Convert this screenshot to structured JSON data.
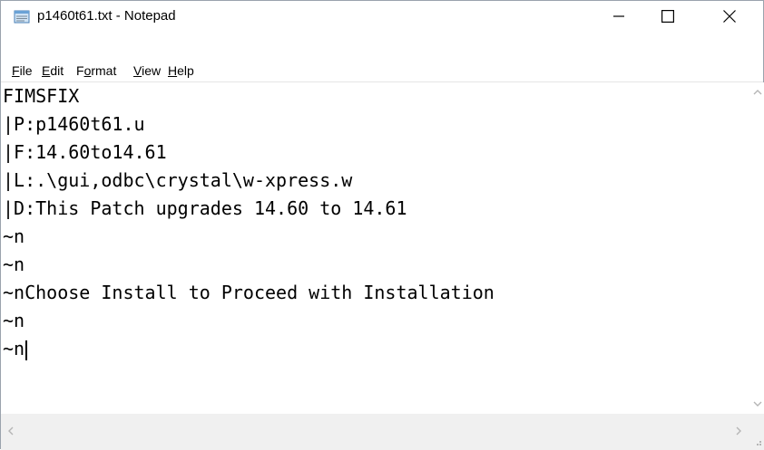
{
  "window": {
    "title": "p1460t61.txt - Notepad"
  },
  "menu": {
    "file": {
      "mnemonic": "F",
      "rest": "ile"
    },
    "edit": {
      "mnemonic": "E",
      "rest": "dit"
    },
    "format": {
      "pre": "F",
      "mnemonic": "o",
      "rest": "rmat"
    },
    "view": {
      "mnemonic": "V",
      "rest": "iew"
    },
    "help": {
      "mnemonic": "H",
      "rest": "elp"
    }
  },
  "editor": {
    "lines": [
      "FIMSFIX",
      "|P:p1460t61.u",
      "|F:14.60to14.61",
      "|L:.\\gui,odbc\\crystal\\w-xpress.w",
      "|D:This Patch upgrades 14.60 to 14.61",
      "~n",
      "~n",
      "~nChoose Install to Proceed with Installation",
      "~n",
      "~n"
    ]
  },
  "icons": {
    "app": "notepad-icon",
    "minimize": "minimize-icon",
    "maximize": "maximize-icon",
    "close": "close-icon"
  }
}
